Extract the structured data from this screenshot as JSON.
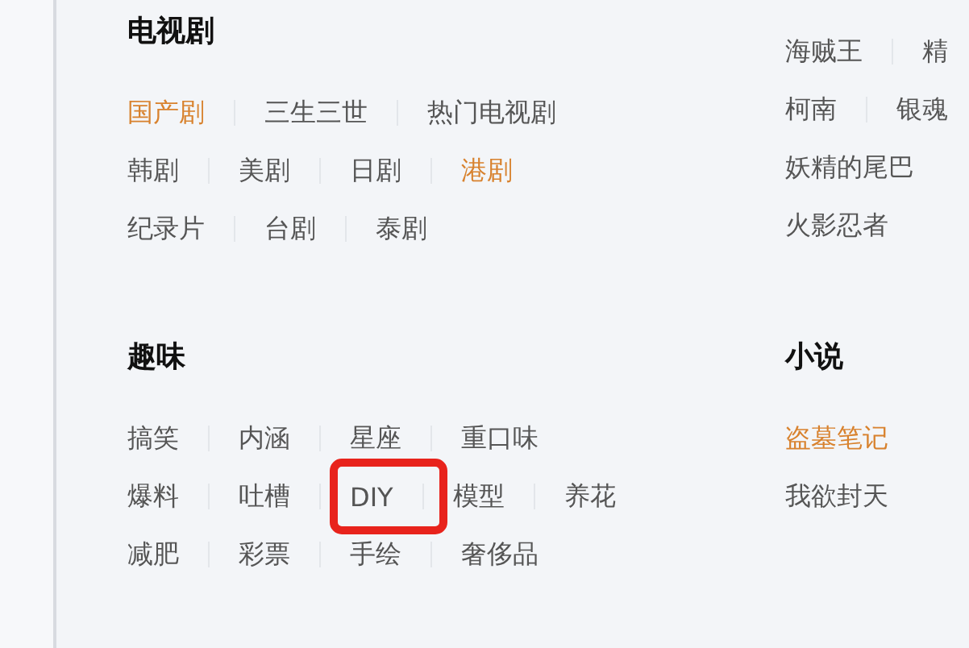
{
  "left_sections": [
    {
      "title": "电视剧",
      "lines": [
        {
          "links": [
            {
              "label": "国产剧",
              "hot": true
            },
            {
              "label": "三生三世",
              "hot": false
            },
            {
              "label": "热门电视剧",
              "hot": false
            }
          ]
        },
        {
          "links": [
            {
              "label": "韩剧",
              "hot": false
            },
            {
              "label": "美剧",
              "hot": false
            },
            {
              "label": "日剧",
              "hot": false
            },
            {
              "label": "港剧",
              "hot": true
            }
          ]
        },
        {
          "links": [
            {
              "label": "纪录片",
              "hot": false
            },
            {
              "label": "台剧",
              "hot": false
            },
            {
              "label": "泰剧",
              "hot": false
            }
          ]
        }
      ]
    },
    {
      "title": "趣味",
      "lines": [
        {
          "links": [
            {
              "label": "搞笑",
              "hot": false
            },
            {
              "label": "内涵",
              "hot": false
            },
            {
              "label": "星座",
              "hot": false
            },
            {
              "label": "重口味",
              "hot": false
            }
          ]
        },
        {
          "links": [
            {
              "label": "爆料",
              "hot": false
            },
            {
              "label": "吐槽",
              "hot": false
            },
            {
              "label": "DIY",
              "hot": false
            },
            {
              "label": "模型",
              "hot": false
            },
            {
              "label": "养花",
              "hot": false
            }
          ]
        },
        {
          "links": [
            {
              "label": "减肥",
              "hot": false
            },
            {
              "label": "彩票",
              "hot": false
            },
            {
              "label": "手绘",
              "hot": false
            },
            {
              "label": "奢侈品",
              "hot": false
            }
          ]
        }
      ]
    }
  ],
  "right_sections": [
    {
      "lines": [
        {
          "links": [
            {
              "label": "海贼王",
              "hot": false
            },
            {
              "label": "精",
              "hot": false
            }
          ]
        },
        {
          "links": [
            {
              "label": "柯南",
              "hot": false
            },
            {
              "label": "银魂",
              "hot": false
            }
          ]
        },
        {
          "links": [
            {
              "label": "妖精的尾巴",
              "hot": false
            }
          ]
        },
        {
          "links": [
            {
              "label": "火影忍者",
              "hot": false
            }
          ]
        }
      ]
    },
    {
      "title": "小说",
      "lines": [
        {
          "links": [
            {
              "label": "盗墓笔记",
              "hot": true
            }
          ]
        },
        {
          "links": [
            {
              "label": "我欲封天",
              "hot": false
            }
          ]
        }
      ]
    }
  ]
}
